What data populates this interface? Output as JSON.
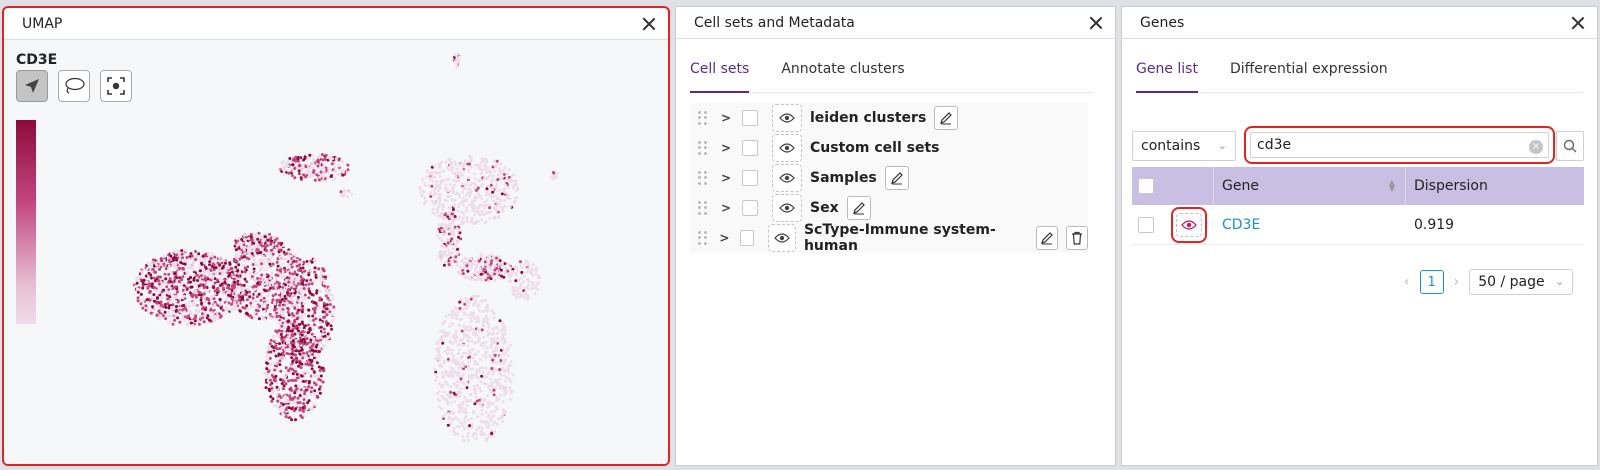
{
  "umap": {
    "title": "UMAP",
    "gene_label": "CD3E",
    "colors": {
      "high": "#8c0b3e",
      "mid": "#c2467d",
      "low": "#eedceb"
    }
  },
  "cellsets": {
    "title": "Cell sets and Metadata",
    "tabs": [
      {
        "label": "Cell sets",
        "active": true
      },
      {
        "label": "Annotate clusters",
        "active": false
      }
    ],
    "items": [
      {
        "label": "leiden clusters",
        "edit": true,
        "delete": false
      },
      {
        "label": "Custom cell sets",
        "edit": false,
        "delete": false
      },
      {
        "label": "Samples",
        "edit": true,
        "delete": false
      },
      {
        "label": "Sex",
        "edit": true,
        "delete": false
      },
      {
        "label": "ScType-Immune system-human",
        "edit": true,
        "delete": true
      }
    ]
  },
  "genes": {
    "title": "Genes",
    "tabs": [
      {
        "label": "Gene list",
        "active": true
      },
      {
        "label": "Differential expression",
        "active": false
      }
    ],
    "filter_mode": "contains",
    "search_value": "cd3e",
    "columns": {
      "gene": "Gene",
      "dispersion": "Dispersion"
    },
    "rows": [
      {
        "gene": "CD3E",
        "dispersion": "0.919"
      }
    ],
    "pager": {
      "current": "1",
      "page_size": "50 / page"
    }
  }
}
